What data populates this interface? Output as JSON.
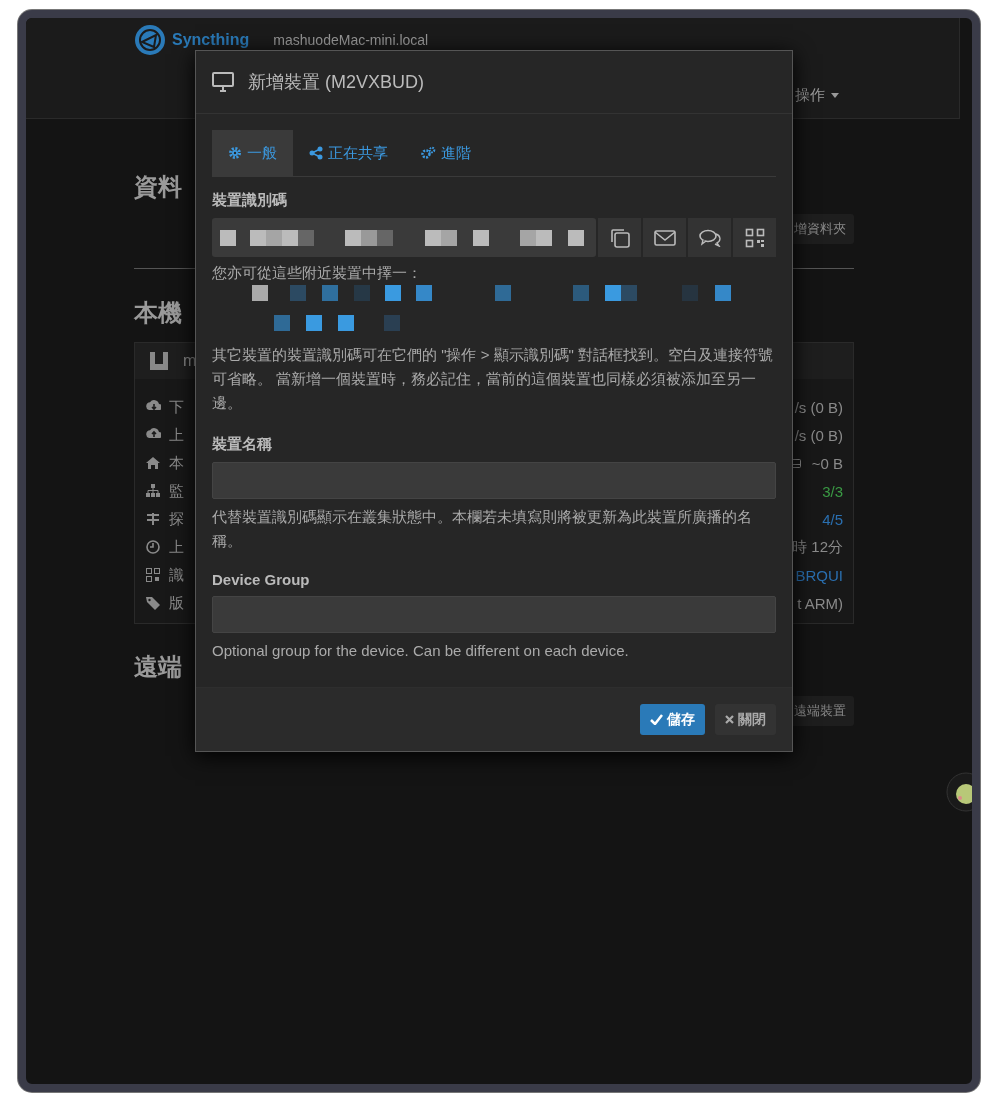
{
  "navbar": {
    "brand": "Syncthing",
    "hostname": "mashuodeMac-mini.local",
    "actions_menu": "操作"
  },
  "background": {
    "folders_heading": "資料",
    "add_folder_button": "增資料夾",
    "this_device_heading": "本機",
    "device_card": {
      "name": "m",
      "rows": [
        {
          "label": "下",
          "value": "/s (0 B)",
          "kind": "plain"
        },
        {
          "label": "上",
          "value": "/s (0 B)",
          "kind": "plain"
        },
        {
          "label": "本",
          "value": "~0 B",
          "kind": "disk"
        },
        {
          "label": "監",
          "value": "3/3",
          "kind": "good"
        },
        {
          "label": "探",
          "value": "4/5",
          "kind": "link"
        },
        {
          "label": "上",
          "value": "時 12分",
          "kind": "plain"
        },
        {
          "label": "識",
          "value": "BRQUI",
          "kind": "link"
        },
        {
          "label": "版",
          "value": "t ARM)",
          "kind": "plain"
        }
      ]
    },
    "remote_heading": "遠端",
    "add_remote_button": "遠端裝置"
  },
  "dialog": {
    "title": "新增裝置 (M2VXBUD)",
    "tabs": [
      {
        "label": "一般",
        "selected": true
      },
      {
        "label": "正在共享",
        "selected": false
      },
      {
        "label": "進階",
        "selected": false
      }
    ],
    "id_label": "裝置識別碼",
    "nearby_hint": "您亦可從這些附近裝置中擇一：",
    "id_help": "其它裝置的裝置識別碼可在它們的 \"操作 > 顯示識別碼\" 對話框找到。空白及連接符號可省略。 當新增一個裝置時，務必記住，當前的這個裝置也同樣必須被添加至另一邊。",
    "name_label": "裝置名稱",
    "name_help": "代替裝置識別碼顯示在叢集狀態中。本欄若未填寫則將被更新為此裝置所廣播的名稱。",
    "group_label": "Device Group",
    "group_help": "Optional group for the device. Can be different on each device.",
    "buttons": [
      {
        "label": "儲存",
        "kind": "primary"
      },
      {
        "label": "關閉",
        "kind": "default"
      }
    ]
  }
}
